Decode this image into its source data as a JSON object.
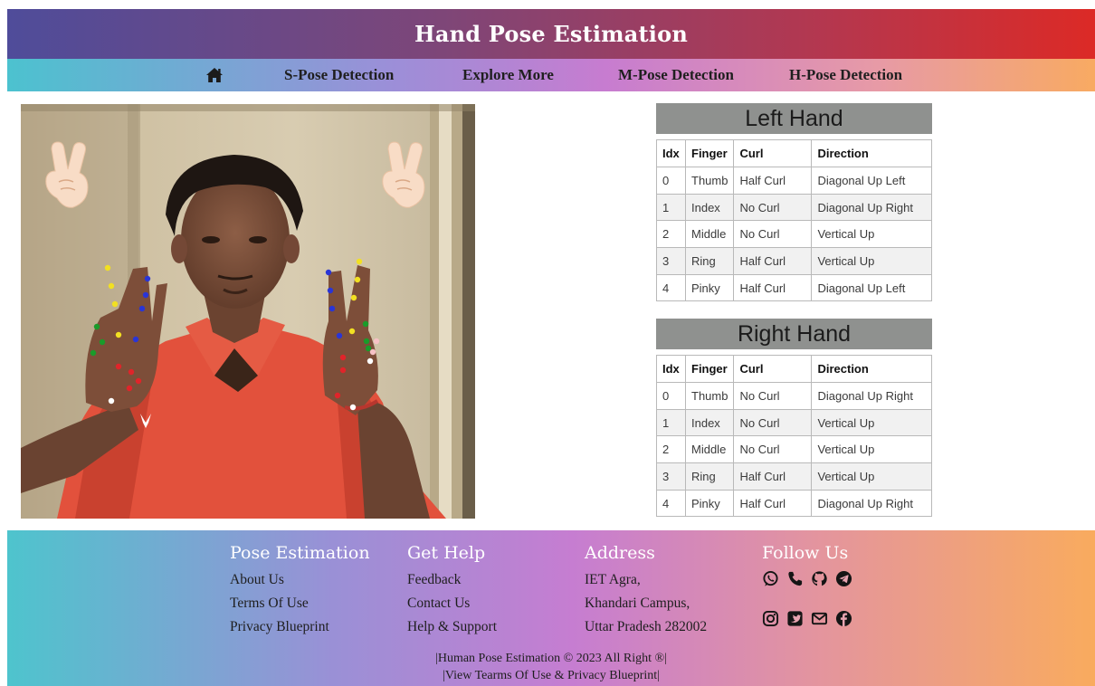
{
  "header": {
    "title": "Hand Pose Estimation"
  },
  "nav": {
    "home_icon": "home-icon",
    "items": [
      "S-Pose Detection",
      "Explore More",
      "M-Pose Detection",
      "H-Pose Detection"
    ]
  },
  "hands": [
    {
      "title": "Left Hand",
      "columns": [
        "Idx",
        "Finger",
        "Curl",
        "Direction"
      ],
      "rows": [
        [
          "0",
          "Thumb",
          "Half Curl",
          "Diagonal Up Left"
        ],
        [
          "1",
          "Index",
          "No Curl",
          "Diagonal Up Right"
        ],
        [
          "2",
          "Middle",
          "No Curl",
          "Vertical Up"
        ],
        [
          "3",
          "Ring",
          "Half Curl",
          "Vertical Up"
        ],
        [
          "4",
          "Pinky",
          "Half Curl",
          "Diagonal Up Left"
        ]
      ]
    },
    {
      "title": "Right Hand",
      "columns": [
        "Idx",
        "Finger",
        "Curl",
        "Direction"
      ],
      "rows": [
        [
          "0",
          "Thumb",
          "No Curl",
          "Diagonal Up Right"
        ],
        [
          "1",
          "Index",
          "No Curl",
          "Vertical Up"
        ],
        [
          "2",
          "Middle",
          "No Curl",
          "Vertical Up"
        ],
        [
          "3",
          "Ring",
          "Half Curl",
          "Vertical Up"
        ],
        [
          "4",
          "Pinky",
          "Half Curl",
          "Diagonal Up Right"
        ]
      ]
    }
  ],
  "photo": {
    "gesture_icons": [
      "victory-hand-icon",
      "victory-hand-icon"
    ]
  },
  "footer": {
    "columns": [
      {
        "title": "Pose Estimation",
        "links": [
          "About Us",
          "Terms Of Use",
          "Privacy Blueprint"
        ]
      },
      {
        "title": "Get Help",
        "links": [
          "Feedback",
          "Contact Us",
          "Help & Support"
        ]
      },
      {
        "title": "Address",
        "lines": [
          "IET Agra,",
          "Khandari Campus,",
          "Uttar Pradesh 282002"
        ]
      },
      {
        "title": "Follow Us",
        "icons": [
          [
            "whatsapp-icon",
            "phone-icon",
            "github-icon",
            "telegram-icon"
          ],
          [
            "instagram-icon",
            "twitter-icon",
            "mail-icon",
            "facebook-icon"
          ]
        ]
      }
    ],
    "copyright": "|Human Pose Estimation © 2023 All Right ®|",
    "terms_line": "|View Tearms Of Use & Privacy Blueprint|"
  },
  "colors": {
    "header_start": "#4f4c9a",
    "header_end": "#dc2a26",
    "band_start": "#4cc2cf",
    "band_mid": "#c77cd0",
    "band_end": "#f8aa62",
    "table_title_bg": "#8f918f"
  }
}
